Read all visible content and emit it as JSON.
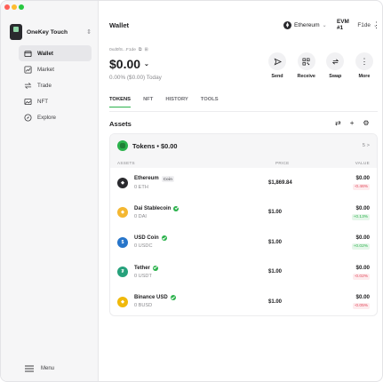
{
  "sidebar": {
    "device": "OneKey Touch",
    "items": [
      {
        "label": "Wallet",
        "icon": "wallet-icon"
      },
      {
        "label": "Market",
        "icon": "chart-icon"
      },
      {
        "label": "Trade",
        "icon": "swap-icon"
      },
      {
        "label": "NFT",
        "icon": "image-icon"
      },
      {
        "label": "Explore",
        "icon": "compass-icon"
      }
    ],
    "menu": "Menu"
  },
  "header": {
    "title": "Wallet",
    "network": "Ethereum",
    "account": "EVM #1",
    "account_id": "F1de"
  },
  "wallet": {
    "address": "0xd0fS...F1de",
    "balance": "$0.00",
    "change": "0.00% ($0.00) Today"
  },
  "actions": [
    "Send",
    "Receive",
    "Swap",
    "More"
  ],
  "tabs": [
    "TOKENS",
    "NFT",
    "HISTORY",
    "TOOLS"
  ],
  "assets_title": "Assets",
  "tokens": {
    "title": "Tokens • $0.00",
    "count": "5 >",
    "columns": [
      "ASSETS",
      "PRICE",
      "VALUE"
    ],
    "rows": [
      {
        "name": "Ethereum",
        "badge": "Coin",
        "balance": "0 ETH",
        "price": "$1,869.84",
        "value": "$0.00",
        "change": "-0.46%",
        "color": "#2a2a2e"
      },
      {
        "name": "Dai Stablecoin",
        "balance": "0 DAI",
        "price": "$1.00",
        "value": "$0.00",
        "change": "+0.13%",
        "color": "#f4b731"
      },
      {
        "name": "USD Coin",
        "balance": "0 USDC",
        "price": "$1.00",
        "value": "$0.00",
        "change": "+0.02%",
        "color": "#2775ca"
      },
      {
        "name": "Tether",
        "balance": "0 USDT",
        "price": "$1.00",
        "value": "$0.00",
        "change": "-0.02%",
        "color": "#26a17b"
      },
      {
        "name": "Binance USD",
        "balance": "0 BUSD",
        "price": "$1.00",
        "value": "$0.00",
        "change": "-0.05%",
        "color": "#f0b90b"
      }
    ]
  }
}
